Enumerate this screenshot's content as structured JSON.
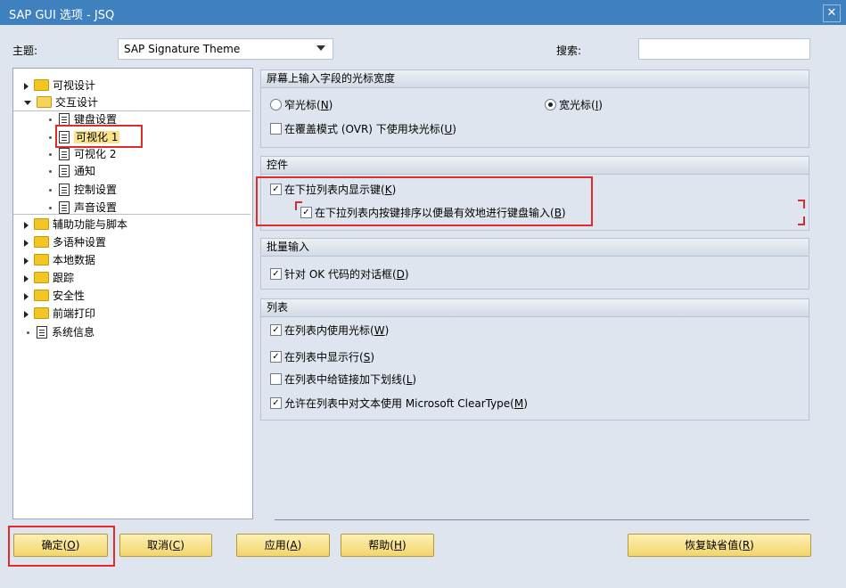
{
  "window": {
    "title": "SAP GUI 选项 - JSQ",
    "close_label": "✕"
  },
  "top": {
    "theme_label": "主题:",
    "theme_value": "SAP Signature Theme",
    "search_label": "搜索:",
    "search_value": ""
  },
  "tree": {
    "items": [
      {
        "label": "可视设计"
      },
      {
        "label": "交互设计"
      },
      {
        "label": "键盘设置"
      },
      {
        "label": "可视化 1"
      },
      {
        "label": "可视化 2"
      },
      {
        "label": "通知"
      },
      {
        "label": "控制设置"
      },
      {
        "label": "声音设置"
      },
      {
        "label": "辅助功能与脚本"
      },
      {
        "label": "多语种设置"
      },
      {
        "label": "本地数据"
      },
      {
        "label": "跟踪"
      },
      {
        "label": "安全性"
      },
      {
        "label": "前端打印"
      },
      {
        "label": "系统信息"
      }
    ]
  },
  "groups": {
    "cursor": {
      "title": "屏幕上输入字段的光标宽度",
      "narrow": {
        "text": "窄光标(",
        "key": "N",
        "end": ")"
      },
      "wide": {
        "text": "宽光标(",
        "key": "I",
        "end": ")"
      },
      "block": {
        "text": "在覆盖模式 (OVR) 下使用块光标(",
        "key": "U",
        "end": ")"
      }
    },
    "controls": {
      "title": "控件",
      "show_key": {
        "text": "在下拉列表内显示键(",
        "key": "K",
        "end": ")"
      },
      "sort_key": {
        "text": "在下拉列表内按键排序以便最有效地进行键盘输入(",
        "key": "B",
        "end": ")"
      }
    },
    "batch": {
      "title": "批量输入",
      "ok_dialog": {
        "text": "针对 OK 代码的对话框(",
        "key": "D",
        "end": ")"
      }
    },
    "list": {
      "title": "列表",
      "cursor": {
        "text": "在列表内使用光标(",
        "key": "W",
        "end": ")"
      },
      "lines": {
        "text": "在列表中显示行(",
        "key": "S",
        "end": ")"
      },
      "underline": {
        "text": "在列表中给链接加下划线(",
        "key": "L",
        "end": ")"
      },
      "cleartype": {
        "text": "允许在列表中对文本使用 Microsoft ClearType(",
        "key": "M",
        "end": ")"
      }
    }
  },
  "buttons": {
    "ok": {
      "text": "确定(",
      "key": "O",
      "end": ")"
    },
    "cancel": {
      "text": "取消(",
      "key": "C",
      "end": ")"
    },
    "apply": {
      "text": "应用(",
      "key": "A",
      "end": ")"
    },
    "help": {
      "text": "帮助(",
      "key": "H",
      "end": ")"
    },
    "restore": {
      "text": "恢复缺省值(",
      "key": "R",
      "end": ")"
    }
  },
  "checkmark": "✓",
  "colors": {
    "titlebar": "#3f80bf",
    "highlight": "#e02b2b",
    "button": "#f2d56a"
  }
}
